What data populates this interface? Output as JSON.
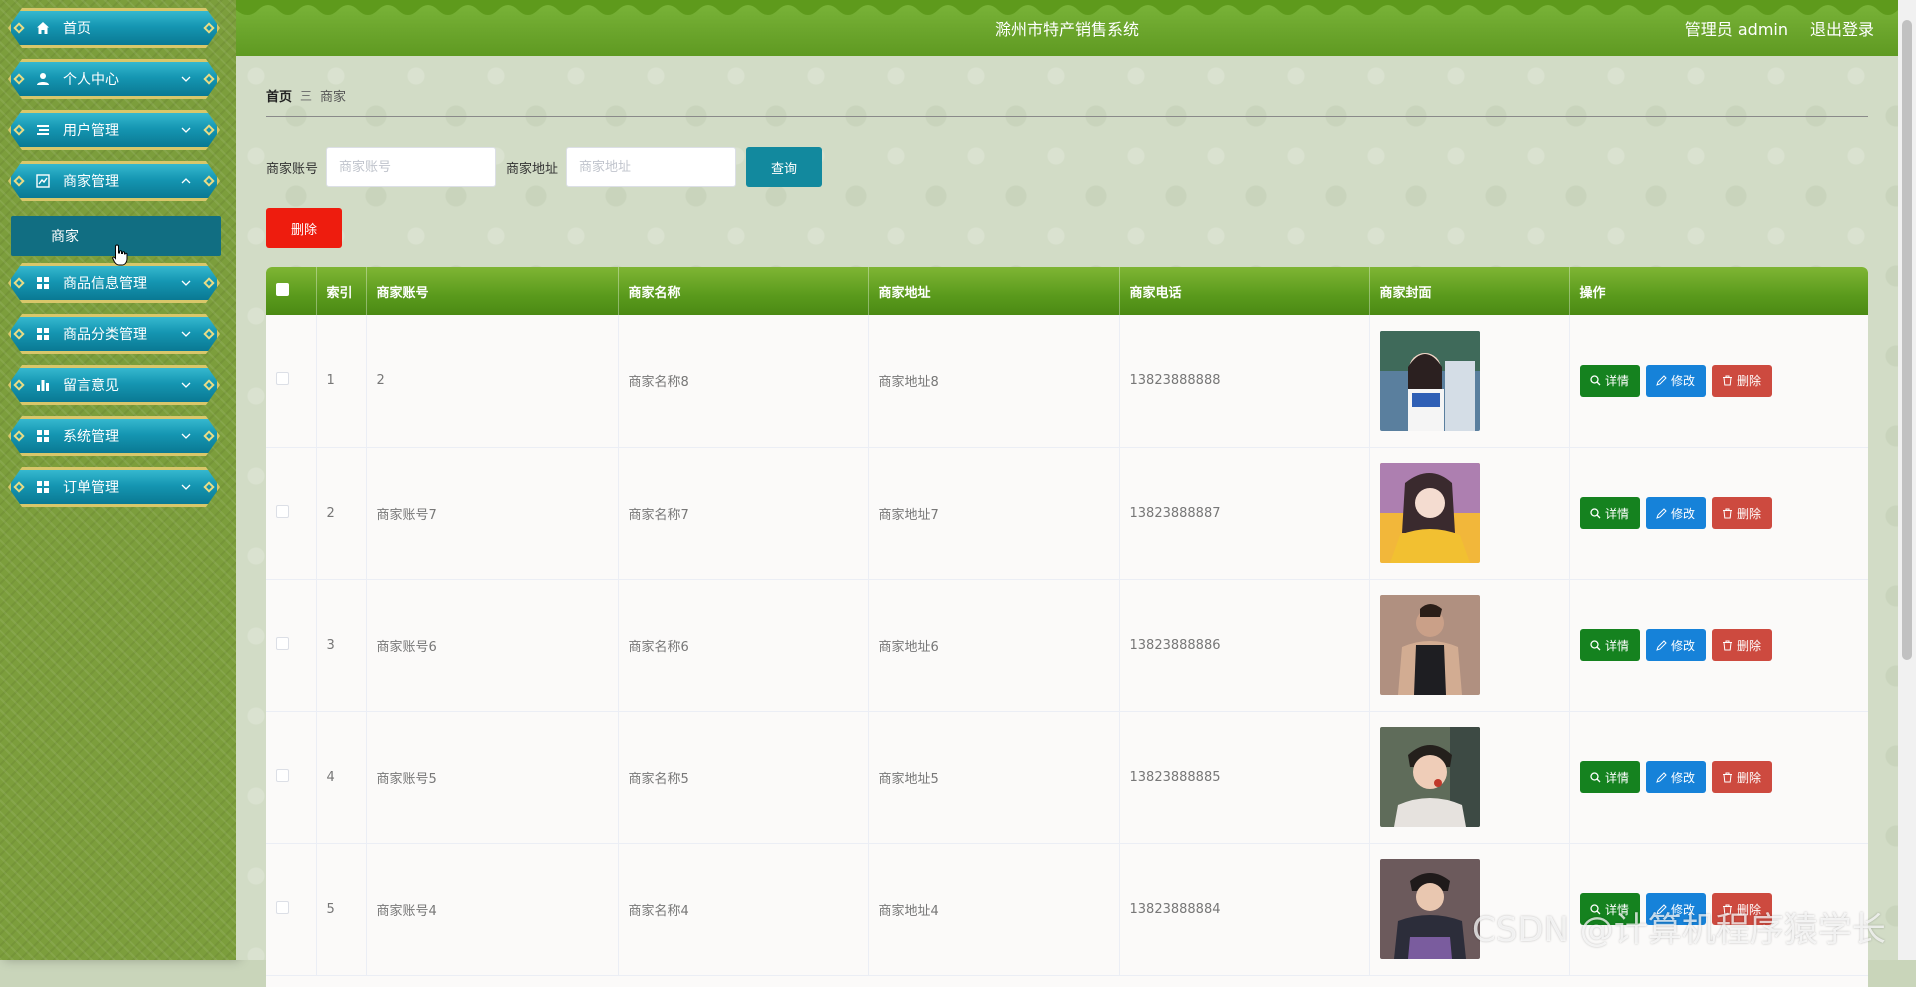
{
  "header": {
    "title": "滁州市特产销售系统",
    "admin_label": "管理员 admin",
    "logout_label": "退出登录"
  },
  "sidebar": {
    "items": [
      {
        "label": "首页",
        "icon": "home-icon"
      },
      {
        "label": "个人中心",
        "icon": "user-icon"
      },
      {
        "label": "用户管理",
        "icon": "list-icon"
      },
      {
        "label": "商家管理",
        "icon": "chart-line-icon"
      },
      {
        "label": "商品信息管理",
        "icon": "grid-icon"
      },
      {
        "label": "商品分类管理",
        "icon": "grid-icon"
      },
      {
        "label": "留言意见",
        "icon": "bar-chart-icon"
      },
      {
        "label": "系统管理",
        "icon": "grid-icon"
      },
      {
        "label": "订单管理",
        "icon": "grid-icon"
      }
    ],
    "submenu": {
      "label": "商家"
    }
  },
  "breadcrumb": {
    "home": "首页",
    "separator": "三",
    "current": "商家"
  },
  "search": {
    "account_label": "商家账号",
    "account_placeholder": "商家账号",
    "address_label": "商家地址",
    "address_placeholder": "商家地址",
    "query_button": "查询"
  },
  "toolbar": {
    "delete_label": "删除"
  },
  "table": {
    "columns": [
      "索引",
      "商家账号",
      "商家名称",
      "商家地址",
      "商家电话",
      "商家封面",
      "操作"
    ],
    "actions": {
      "detail": "详情",
      "edit": "修改",
      "delete": "删除"
    },
    "rows": [
      {
        "index": "1",
        "account": "2",
        "name": "商家名称8",
        "address": "商家地址8",
        "phone": "13823888888"
      },
      {
        "index": "2",
        "account": "商家账号7",
        "name": "商家名称7",
        "address": "商家地址7",
        "phone": "13823888887"
      },
      {
        "index": "3",
        "account": "商家账号6",
        "name": "商家名称6",
        "address": "商家地址6",
        "phone": "13823888886"
      },
      {
        "index": "4",
        "account": "商家账号5",
        "name": "商家名称5",
        "address": "商家地址5",
        "phone": "13823888885"
      },
      {
        "index": "5",
        "account": "商家账号4",
        "name": "商家名称4",
        "address": "商家地址4",
        "phone": "13823888884"
      }
    ]
  },
  "watermark": "CSDN @计算机程序猿学长",
  "colors": {
    "header_green": "#6aa42b",
    "menu_teal": "#1596b2",
    "query_button": "#12899e",
    "delete_red": "#ee1c0e",
    "detail_green": "#15821f",
    "edit_blue": "#1682d9",
    "delete_op": "#cd4a3f"
  }
}
